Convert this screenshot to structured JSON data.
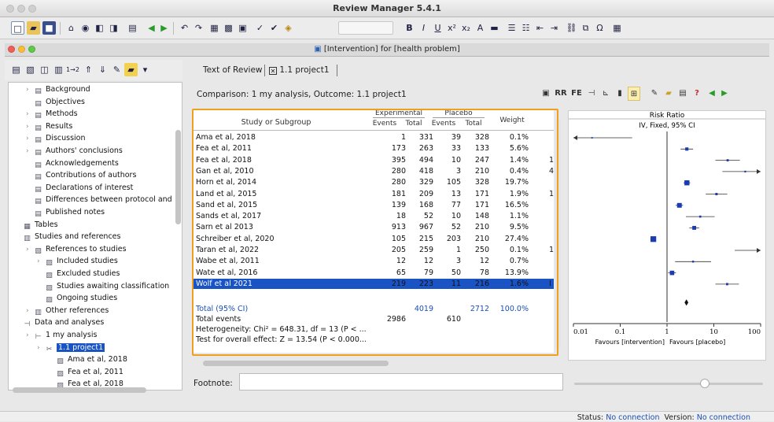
{
  "app": {
    "title": "Review Manager 5.4.1"
  },
  "window": {
    "title": "[Intervention] for [health problem]"
  },
  "tree": {
    "items": [
      {
        "label": "Background",
        "icon": "document-icon",
        "level": 1,
        "chevron": true
      },
      {
        "label": "Objectives",
        "icon": "document-icon",
        "level": 1,
        "chevron": false
      },
      {
        "label": "Methods",
        "icon": "document-icon",
        "level": 1,
        "chevron": true
      },
      {
        "label": "Results",
        "icon": "document-icon",
        "level": 1,
        "chevron": true
      },
      {
        "label": "Discussion",
        "icon": "document-icon",
        "level": 1,
        "chevron": true
      },
      {
        "label": "Authors' conclusions",
        "icon": "document-icon",
        "level": 1,
        "chevron": true
      },
      {
        "label": "Acknowledgements",
        "icon": "document-icon",
        "level": 1,
        "chevron": false
      },
      {
        "label": "Contributions of authors",
        "icon": "document-icon",
        "level": 1,
        "chevron": false
      },
      {
        "label": "Declarations of interest",
        "icon": "document-icon",
        "level": 1,
        "chevron": false
      },
      {
        "label": "Differences between protocol and",
        "icon": "document-icon",
        "level": 1,
        "chevron": false
      },
      {
        "label": "Published notes",
        "icon": "document-icon",
        "level": 1,
        "chevron": false
      },
      {
        "label": "Tables",
        "icon": "table-icon",
        "level": 0,
        "chevron": false
      },
      {
        "label": "Studies and references",
        "icon": "books-icon",
        "level": 0,
        "chevron": false
      },
      {
        "label": "References to studies",
        "icon": "references-icon",
        "level": 1,
        "chevron": true
      },
      {
        "label": "Included studies",
        "icon": "studies-icon",
        "level": 2,
        "chevron": true
      },
      {
        "label": "Excluded studies",
        "icon": "studies-icon",
        "level": 2,
        "chevron": false
      },
      {
        "label": "Studies awaiting classification",
        "icon": "studies-icon",
        "level": 2,
        "chevron": false
      },
      {
        "label": "Ongoing studies",
        "icon": "studies-icon",
        "level": 2,
        "chevron": false
      },
      {
        "label": "Other references",
        "icon": "books-icon",
        "level": 1,
        "chevron": true
      },
      {
        "label": "Data and analyses",
        "icon": "analysis-icon",
        "level": 0,
        "chevron": false
      },
      {
        "label": "1 my analysis",
        "icon": "comparison-icon",
        "level": 1,
        "chevron": true
      },
      {
        "label": "1.1 project1",
        "icon": "outcome-icon",
        "level": 2,
        "chevron": true,
        "selected": true
      },
      {
        "label": "Ama et al, 2018",
        "icon": "study-data-icon",
        "level": 3,
        "chevron": false
      },
      {
        "label": "Fea et al, 2011",
        "icon": "study-data-icon",
        "level": 3,
        "chevron": false
      },
      {
        "label": "Fea et al, 2018",
        "icon": "study-data-icon",
        "level": 3,
        "chevron": false
      }
    ]
  },
  "tabs": [
    {
      "label": "Text of Review"
    },
    {
      "label": "1.1 project1"
    }
  ],
  "comparison": {
    "text": "Comparison: 1 my analysis, Outcome: 1.1 project1"
  },
  "table": {
    "headers": {
      "study": "Study or Subgroup",
      "experimental": "Experimental",
      "placebo": "Placebo",
      "events": "Events",
      "total": "Total",
      "weight": "Weight"
    },
    "rows": [
      {
        "study": "Ama et al, 2018",
        "exp_events": "1",
        "exp_total": "331",
        "pla_events": "39",
        "pla_total": "328",
        "weight": "0.1%",
        "extra": "",
        "rr": 0.025,
        "lo": 0.003,
        "hi": 0.18
      },
      {
        "study": "Fea et al, 2011",
        "exp_events": "173",
        "exp_total": "263",
        "pla_events": "33",
        "pla_total": "133",
        "weight": "5.6%",
        "extra": "",
        "rr": 2.65,
        "lo": 1.95,
        "hi": 3.6
      },
      {
        "study": "Fea et al, 2018",
        "exp_events": "395",
        "exp_total": "494",
        "pla_events": "10",
        "pla_total": "247",
        "weight": "1.4%",
        "extra": "1",
        "rr": 19.75,
        "lo": 10.8,
        "hi": 36
      },
      {
        "study": "Gan et al, 2010",
        "exp_events": "280",
        "exp_total": "418",
        "pla_events": "3",
        "pla_total": "210",
        "weight": "0.4%",
        "extra": "4",
        "rr": 46.9,
        "lo": 15.2,
        "hi": 145
      },
      {
        "study": "Horn et al, 2014",
        "exp_events": "280",
        "exp_total": "329",
        "pla_events": "105",
        "pla_total": "328",
        "weight": "19.7%",
        "extra": "",
        "rr": 2.66,
        "lo": 2.25,
        "hi": 3.13
      },
      {
        "study": "Land et al, 2015",
        "exp_events": "181",
        "exp_total": "209",
        "pla_events": "13",
        "pla_total": "171",
        "weight": "1.9%",
        "extra": "1",
        "rr": 11.39,
        "lo": 6.7,
        "hi": 19.4
      },
      {
        "study": "Sand et al, 2015",
        "exp_events": "139",
        "exp_total": "168",
        "pla_events": "77",
        "pla_total": "171",
        "weight": "16.5%",
        "extra": "",
        "rr": 1.84,
        "lo": 1.53,
        "hi": 2.2
      },
      {
        "study": "Sands et al, 2017",
        "exp_events": "18",
        "exp_total": "52",
        "pla_events": "10",
        "pla_total": "148",
        "weight": "1.1%",
        "extra": "",
        "rr": 5.12,
        "lo": 2.53,
        "hi": 10.4
      },
      {
        "study": "Sarn et al 2013",
        "exp_events": "913",
        "exp_total": "967",
        "pla_events": "52",
        "pla_total": "210",
        "weight": "9.5%",
        "extra": "",
        "rr": 3.81,
        "lo": 3.0,
        "hi": 4.85
      },
      {
        "study": "Schreiber et al, 2020",
        "exp_events": "105",
        "exp_total": "215",
        "pla_events": "203",
        "pla_total": "210",
        "weight": "27.4%",
        "extra": "",
        "rr": 0.51,
        "lo": 0.44,
        "hi": 0.58
      },
      {
        "study": "Taran et al, 2022",
        "exp_events": "205",
        "exp_total": "259",
        "pla_events": "1",
        "pla_total": "250",
        "weight": "0.1%",
        "extra": "1",
        "rr": 197.9,
        "lo": 27.9,
        "hi": 1400
      },
      {
        "study": "Wabe et al, 2011",
        "exp_events": "12",
        "exp_total": "12",
        "pla_events": "3",
        "pla_total": "12",
        "weight": "0.7%",
        "extra": "",
        "rr": 3.6,
        "lo": 1.49,
        "hi": 8.72
      },
      {
        "study": "Wate et al, 2016",
        "exp_events": "65",
        "exp_total": "79",
        "pla_events": "50",
        "pla_total": "78",
        "weight": "13.9%",
        "extra": "",
        "rr": 1.28,
        "lo": 1.06,
        "hi": 1.55
      },
      {
        "study": "Wolf et al 2021",
        "exp_events": "219",
        "exp_total": "223",
        "pla_events": "11",
        "pla_total": "216",
        "weight": "1.6%",
        "extra": "I",
        "rr": 19.28,
        "lo": 10.8,
        "hi": 34.4,
        "selected": true
      }
    ],
    "total": {
      "label": "Total (95% CI)",
      "exp_total": "4019",
      "pla_total": "2712",
      "weight": "100.0%",
      "rr": 2.6,
      "lo": 2.37,
      "hi": 2.85
    },
    "total_events": {
      "label": "Total events",
      "exp": "2986",
      "pla": "610"
    },
    "heterogeneity": "Heterogeneity: Chi² = 648.31, df = 13 (P < ...",
    "overall_effect": "Test for overall effect: Z = 13.54 (P < 0.000..."
  },
  "plot": {
    "title": "Risk Ratio",
    "subtitle": "IV, Fixed, 95% CI",
    "ticks": [
      "0.01",
      "0.1",
      "1",
      "10",
      "100"
    ],
    "favours_left": "Favours [intervention]",
    "favours_right": "Favours [placebo]"
  },
  "toolbar_right": {
    "rr_label": "RR",
    "fe_label": "FE"
  },
  "footnote": {
    "label": "Footnote:",
    "value": ""
  },
  "status": {
    "status_label": "Status:",
    "status_value": "No connection",
    "version_label": "Version:",
    "version_value": "No connection"
  },
  "colors": {
    "accent": "#1a53c4",
    "highlight": "#f0a020",
    "link": "#1a4fb5"
  }
}
